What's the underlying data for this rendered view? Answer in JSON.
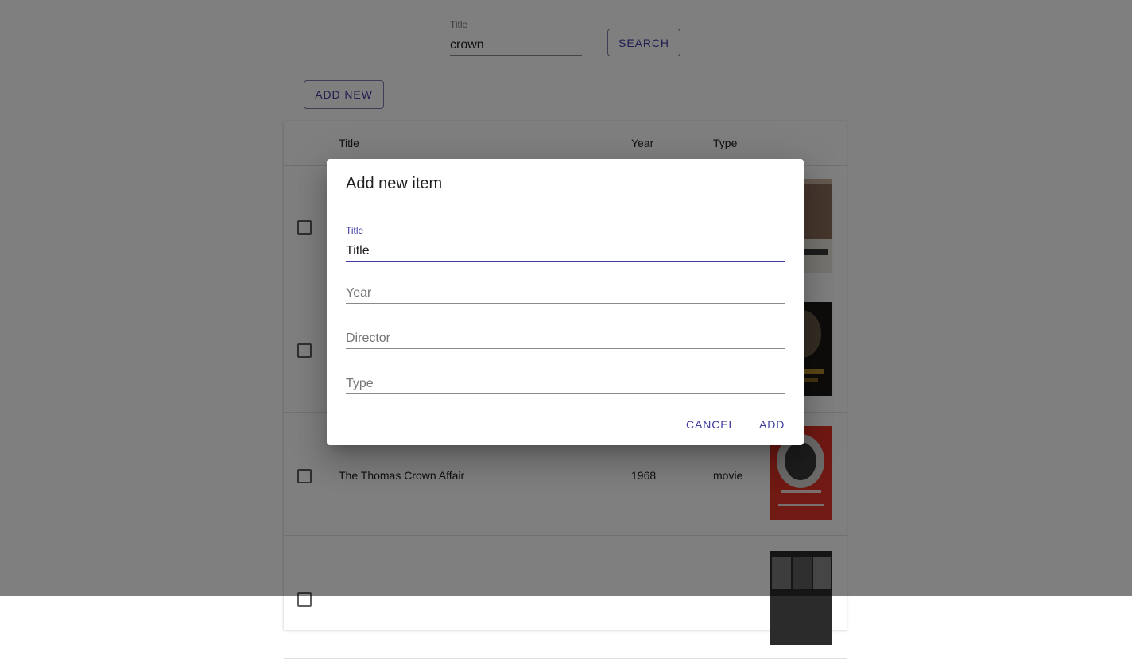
{
  "search": {
    "label": "Title",
    "value": "crown",
    "button_label": "SEARCH"
  },
  "toolbar": {
    "add_new_label": "ADD NEW"
  },
  "table": {
    "headers": {
      "title": "Title",
      "year": "Year",
      "type": "Type"
    },
    "rows": [
      {
        "title": "",
        "year": "",
        "type": "",
        "poster": "poster-image"
      },
      {
        "title": "",
        "year": "",
        "type": "",
        "poster": "poster-image"
      },
      {
        "title": "The Thomas Crown Affair",
        "year": "1968",
        "type": "movie",
        "poster": "poster-image"
      },
      {
        "title": "",
        "year": "",
        "type": "",
        "poster": "poster-image"
      }
    ]
  },
  "dialog": {
    "title": "Add new item",
    "fields": {
      "title": {
        "label": "Title",
        "value": "Title"
      },
      "year": {
        "placeholder": "Year"
      },
      "director": {
        "placeholder": "Director"
      },
      "type": {
        "placeholder": "Type"
      }
    },
    "cancel_label": "CANCEL",
    "add_label": "ADD"
  },
  "colors": {
    "accent": "#3f3a9e",
    "backdrop": "rgba(0,0,0,0.5)"
  }
}
